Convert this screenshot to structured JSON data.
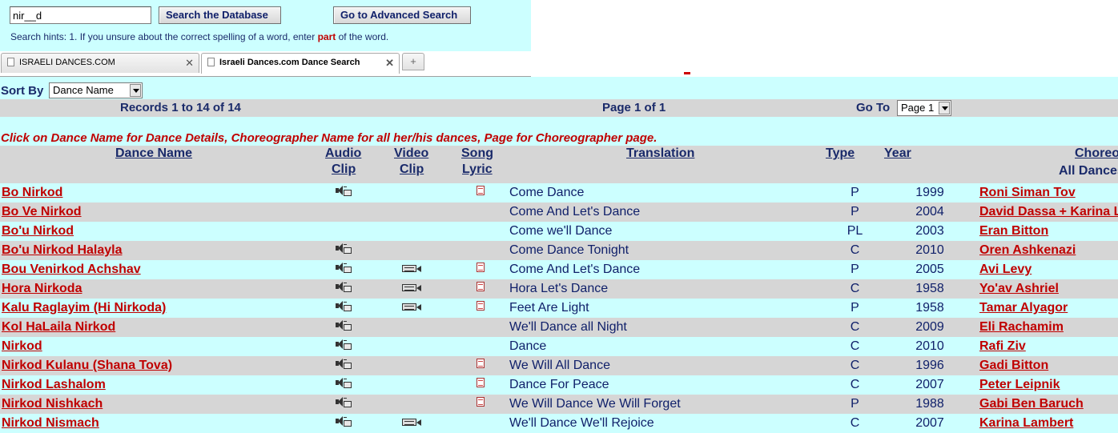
{
  "search": {
    "value": "nir__d",
    "search_button": "Search the Database",
    "advanced_button": "Go to Advanced Search",
    "hint_prefix": "Search hints:   1. If you unsure about the correct spelling of a word, enter ",
    "hint_part": "part",
    "hint_suffix": " of the word."
  },
  "tabs": [
    {
      "label": "ISRAELI DANCES.COM",
      "active": false
    },
    {
      "label": "Israeli Dances.com Dance Search",
      "active": true
    }
  ],
  "sort": {
    "label": "Sort By",
    "selected": "Dance Name"
  },
  "records": {
    "range": "Records 1 to 14 of 14",
    "page": "Page 1 of 1",
    "goto_label": "Go To",
    "goto_selected": "Page 1"
  },
  "note": "Click on Dance Name for Dance Details, Choreographer Name for all her/his dances, Page for Choreographer page.",
  "headers": {
    "dance_name": "Dance Name",
    "audio_1": "Audio",
    "audio_2": "Clip",
    "video_1": "Video",
    "video_2": "Clip",
    "song_1": "Song",
    "song_2": "Lyric",
    "translation": "Translation",
    "type": "Type",
    "year": "Year",
    "chor_1": "Choreographer",
    "chor_2": "All Dances"
  },
  "rows": [
    {
      "name": "Bo Nirkod",
      "audio": true,
      "video": false,
      "lyric": true,
      "translation": "Come Dance",
      "type": "P",
      "year": "1999",
      "chor": "Roni Siman Tov"
    },
    {
      "name": "Bo Ve Nirkod",
      "audio": false,
      "video": false,
      "lyric": false,
      "translation": "Come And Let's Dance",
      "type": "P",
      "year": "2004",
      "chor": "David Dassa + Karina Lambert"
    },
    {
      "name": "Bo'u Nirkod",
      "audio": false,
      "video": false,
      "lyric": false,
      "translation": "Come we'll Dance",
      "type": "PL",
      "year": "2003",
      "chor": "Eran Bitton"
    },
    {
      "name": "Bo'u Nirkod Halayla",
      "audio": true,
      "video": false,
      "lyric": false,
      "translation": "Come Dance Tonight",
      "type": "C",
      "year": "2010",
      "chor": "Oren Ashkenazi"
    },
    {
      "name": "Bou Venirkod Achshav",
      "audio": true,
      "video": true,
      "lyric": true,
      "translation": "Come And Let's Dance",
      "type": "P",
      "year": "2005",
      "chor": "Avi Levy"
    },
    {
      "name": "Hora Nirkoda",
      "audio": true,
      "video": true,
      "lyric": true,
      "translation": "Hora Let's Dance",
      "type": "C",
      "year": "1958",
      "chor": "Yo'av Ashriel"
    },
    {
      "name": "Kalu Raglayim (Hi Nirkoda)",
      "audio": true,
      "video": true,
      "lyric": true,
      "translation": "Feet Are Light",
      "type": "P",
      "year": "1958",
      "chor": "Tamar Alyagor"
    },
    {
      "name": "Kol HaLaila Nirkod",
      "audio": true,
      "video": false,
      "lyric": false,
      "translation": "We'll Dance all Night",
      "type": "C",
      "year": "2009",
      "chor": "Eli Rachamim"
    },
    {
      "name": "Nirkod",
      "audio": true,
      "video": false,
      "lyric": false,
      "translation": "Dance",
      "type": "C",
      "year": "2010",
      "chor": "Rafi Ziv"
    },
    {
      "name": "Nirkod Kulanu (Shana Tova)",
      "audio": true,
      "video": false,
      "lyric": true,
      "translation": "We Will All Dance",
      "type": "C",
      "year": "1996",
      "chor": "Gadi Bitton"
    },
    {
      "name": "Nirkod Lashalom",
      "audio": true,
      "video": false,
      "lyric": true,
      "translation": "Dance For Peace",
      "type": "C",
      "year": "2007",
      "chor": "Peter Leipnik"
    },
    {
      "name": "Nirkod Nishkach",
      "audio": true,
      "video": false,
      "lyric": true,
      "translation": "We Will Dance We Will Forget",
      "type": "P",
      "year": "1988",
      "chor": "Gabi Ben Baruch"
    },
    {
      "name": "Nirkod Nismach",
      "audio": true,
      "video": true,
      "lyric": false,
      "translation": "We'll Dance We'll Rejoice",
      "type": "C",
      "year": "2007",
      "chor": "Karina Lambert"
    }
  ]
}
